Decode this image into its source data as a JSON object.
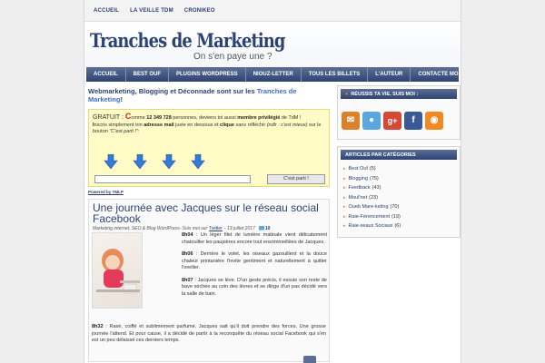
{
  "topbar": {
    "items": [
      "ACCUEIL",
      "LA VEILLE TDM",
      "CRONIKEO"
    ]
  },
  "header": {
    "title": "Tranches de Marketing",
    "tagline": "On s'en paye une ?"
  },
  "nav": {
    "items": [
      "ACCUEIL",
      "BEST OUF",
      "PLUGINS WORDPRESS",
      "NIOUZ-LETTER",
      "TOUS LES BILLETS",
      "L'AUTEUR",
      "CONTACTE MOI"
    ]
  },
  "intro": {
    "part1": "Webmarketing, Blogging et Déconnade sont sur les ",
    "highlight": "Tranches de Marketing",
    "part2": "!"
  },
  "newsletter": {
    "gratuit": "GRATUIT : ",
    "c_letter": "C",
    "t1": "omme ",
    "count": "12 349 728",
    "t2": " personnes, deviens toi aussi ",
    "privilege": "membre privilégié",
    "t3": " de TdM !",
    "i_letter": "I",
    "t4": "nscris simplement ton ",
    "adresse": "adresse mail",
    "t5": " juste en dessous et ",
    "clique": "clique",
    "t6": " sans réfléchir ",
    "indr": "(ndlr : c'est mieux)",
    "t7": " sur le bouton ",
    "quote": "\"C'est parti !\"",
    "t8": ":",
    "button": "C'est parti !",
    "powered": "Powered by YMLP",
    "arrow_icon": "down-arrow-icon",
    "arrow_color": "#2f7bd6"
  },
  "post": {
    "title": "Une journée avec Jacques sur le réseau social Facebook",
    "meta_cats": "Marketing internet, SEO & Blog WordPress",
    "meta_suis": " - Suis moi sur ",
    "meta_twitter": "Twitter",
    "meta_date": " - 13 juillet 2017",
    "comments": "10",
    "p1_time": "8h04",
    "p1_text": " : Un léger filet de lumière matinale vient délicatement chatouiller les paupières encore tout ensommeillées de Jacques.",
    "p2_time": "8h06",
    "p2_text": " : Derrière le volet, les oiseaux gazouillent et la douce chaleur printanière l'invite gentiment et naturellement à quitter l'oreiller.",
    "p3_time": "8h07",
    "p3_text": " : Jacques se lève. D'un geste précis, il essuie son reste de bave séchée au coin des lèvres et se dirige d'un pas décidé vers la salle de bain.",
    "p4_time": "8h32",
    "p4_text": " : Rasé, coiffé et sublimement parfumé, Jacques sait qu'il doit prendre des forces. Une grosse journée l'attend. Et pour cause, il a décidé de partir à la reconquête du réseau social Facebook qui s'en est un peu délaissé ces derniers temps."
  },
  "sidebar": {
    "social_title": "RÉUSSIS TA VIE, SUIS MOI :",
    "social_icons": [
      "rss-email-icon",
      "twitter-bird-icon",
      "google-plus-icon",
      "facebook-icon",
      "rss-icon"
    ],
    "social_glyphs": [
      "✉",
      "●",
      "g+",
      "f",
      "◉"
    ],
    "social_colors": [
      "#d9822b",
      "#5aa7e0",
      "#d34836",
      "#3b5998",
      "#ef8b23"
    ],
    "categories_title": "ARTICLES PAR CATÉGORIES",
    "categories": [
      {
        "name": "Best Ouf",
        "count": "(5)"
      },
      {
        "name": "Blogging",
        "count": "(75)"
      },
      {
        "name": "Feedback",
        "count": "(43)"
      },
      {
        "name": "Moul'net",
        "count": "(23)"
      },
      {
        "name": "Oueb Mare-keting",
        "count": "(70)"
      },
      {
        "name": "Raie-Férencement",
        "count": "(19)"
      },
      {
        "name": "Raie-seaux Sociaux",
        "count": "(6)"
      }
    ]
  }
}
